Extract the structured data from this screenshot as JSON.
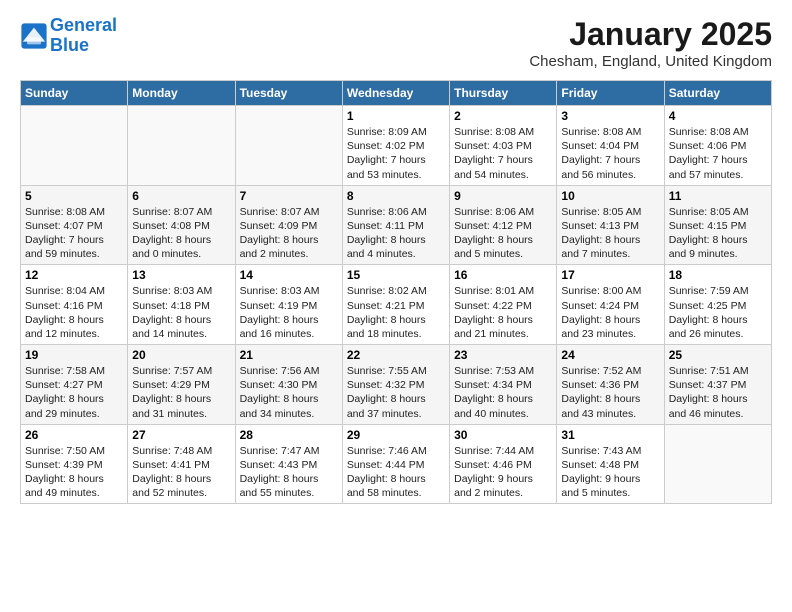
{
  "logo": {
    "text_general": "General",
    "text_blue": "Blue"
  },
  "title": "January 2025",
  "subtitle": "Chesham, England, United Kingdom",
  "weekdays": [
    "Sunday",
    "Monday",
    "Tuesday",
    "Wednesday",
    "Thursday",
    "Friday",
    "Saturday"
  ],
  "weeks": [
    [
      {
        "day": "",
        "info": ""
      },
      {
        "day": "",
        "info": ""
      },
      {
        "day": "",
        "info": ""
      },
      {
        "day": "1",
        "info": "Sunrise: 8:09 AM\nSunset: 4:02 PM\nDaylight: 7 hours\nand 53 minutes."
      },
      {
        "day": "2",
        "info": "Sunrise: 8:08 AM\nSunset: 4:03 PM\nDaylight: 7 hours\nand 54 minutes."
      },
      {
        "day": "3",
        "info": "Sunrise: 8:08 AM\nSunset: 4:04 PM\nDaylight: 7 hours\nand 56 minutes."
      },
      {
        "day": "4",
        "info": "Sunrise: 8:08 AM\nSunset: 4:06 PM\nDaylight: 7 hours\nand 57 minutes."
      }
    ],
    [
      {
        "day": "5",
        "info": "Sunrise: 8:08 AM\nSunset: 4:07 PM\nDaylight: 7 hours\nand 59 minutes."
      },
      {
        "day": "6",
        "info": "Sunrise: 8:07 AM\nSunset: 4:08 PM\nDaylight: 8 hours\nand 0 minutes."
      },
      {
        "day": "7",
        "info": "Sunrise: 8:07 AM\nSunset: 4:09 PM\nDaylight: 8 hours\nand 2 minutes."
      },
      {
        "day": "8",
        "info": "Sunrise: 8:06 AM\nSunset: 4:11 PM\nDaylight: 8 hours\nand 4 minutes."
      },
      {
        "day": "9",
        "info": "Sunrise: 8:06 AM\nSunset: 4:12 PM\nDaylight: 8 hours\nand 5 minutes."
      },
      {
        "day": "10",
        "info": "Sunrise: 8:05 AM\nSunset: 4:13 PM\nDaylight: 8 hours\nand 7 minutes."
      },
      {
        "day": "11",
        "info": "Sunrise: 8:05 AM\nSunset: 4:15 PM\nDaylight: 8 hours\nand 9 minutes."
      }
    ],
    [
      {
        "day": "12",
        "info": "Sunrise: 8:04 AM\nSunset: 4:16 PM\nDaylight: 8 hours\nand 12 minutes."
      },
      {
        "day": "13",
        "info": "Sunrise: 8:03 AM\nSunset: 4:18 PM\nDaylight: 8 hours\nand 14 minutes."
      },
      {
        "day": "14",
        "info": "Sunrise: 8:03 AM\nSunset: 4:19 PM\nDaylight: 8 hours\nand 16 minutes."
      },
      {
        "day": "15",
        "info": "Sunrise: 8:02 AM\nSunset: 4:21 PM\nDaylight: 8 hours\nand 18 minutes."
      },
      {
        "day": "16",
        "info": "Sunrise: 8:01 AM\nSunset: 4:22 PM\nDaylight: 8 hours\nand 21 minutes."
      },
      {
        "day": "17",
        "info": "Sunrise: 8:00 AM\nSunset: 4:24 PM\nDaylight: 8 hours\nand 23 minutes."
      },
      {
        "day": "18",
        "info": "Sunrise: 7:59 AM\nSunset: 4:25 PM\nDaylight: 8 hours\nand 26 minutes."
      }
    ],
    [
      {
        "day": "19",
        "info": "Sunrise: 7:58 AM\nSunset: 4:27 PM\nDaylight: 8 hours\nand 29 minutes."
      },
      {
        "day": "20",
        "info": "Sunrise: 7:57 AM\nSunset: 4:29 PM\nDaylight: 8 hours\nand 31 minutes."
      },
      {
        "day": "21",
        "info": "Sunrise: 7:56 AM\nSunset: 4:30 PM\nDaylight: 8 hours\nand 34 minutes."
      },
      {
        "day": "22",
        "info": "Sunrise: 7:55 AM\nSunset: 4:32 PM\nDaylight: 8 hours\nand 37 minutes."
      },
      {
        "day": "23",
        "info": "Sunrise: 7:53 AM\nSunset: 4:34 PM\nDaylight: 8 hours\nand 40 minutes."
      },
      {
        "day": "24",
        "info": "Sunrise: 7:52 AM\nSunset: 4:36 PM\nDaylight: 8 hours\nand 43 minutes."
      },
      {
        "day": "25",
        "info": "Sunrise: 7:51 AM\nSunset: 4:37 PM\nDaylight: 8 hours\nand 46 minutes."
      }
    ],
    [
      {
        "day": "26",
        "info": "Sunrise: 7:50 AM\nSunset: 4:39 PM\nDaylight: 8 hours\nand 49 minutes."
      },
      {
        "day": "27",
        "info": "Sunrise: 7:48 AM\nSunset: 4:41 PM\nDaylight: 8 hours\nand 52 minutes."
      },
      {
        "day": "28",
        "info": "Sunrise: 7:47 AM\nSunset: 4:43 PM\nDaylight: 8 hours\nand 55 minutes."
      },
      {
        "day": "29",
        "info": "Sunrise: 7:46 AM\nSunset: 4:44 PM\nDaylight: 8 hours\nand 58 minutes."
      },
      {
        "day": "30",
        "info": "Sunrise: 7:44 AM\nSunset: 4:46 PM\nDaylight: 9 hours\nand 2 minutes."
      },
      {
        "day": "31",
        "info": "Sunrise: 7:43 AM\nSunset: 4:48 PM\nDaylight: 9 hours\nand 5 minutes."
      },
      {
        "day": "",
        "info": ""
      }
    ]
  ]
}
